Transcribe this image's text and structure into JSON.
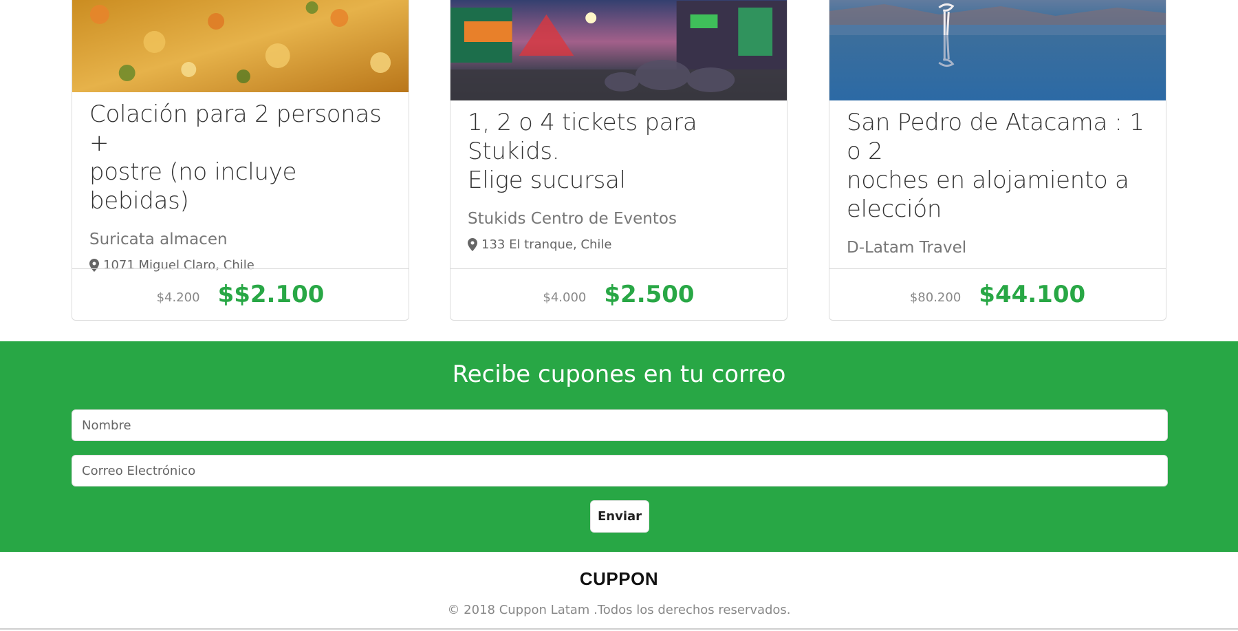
{
  "deals": [
    {
      "image": "food-dish-image",
      "title_line1": "Colación para 2 personas +",
      "title_line2": "postre (no incluye bebidas)",
      "title_line3": "",
      "merchant": "Suricata almacen",
      "address": "1071 Miguel Claro, Chile",
      "old_price": "$4.200",
      "new_price": "$$2.100"
    },
    {
      "image": "amusement-fair-image",
      "title_line1": "1, 2 o 4 tickets para Stukids.",
      "title_line2": "Elige sucursal",
      "title_line3": "",
      "merchant": "Stukids Centro de Eventos",
      "address": "133 El tranque, Chile",
      "old_price": "$4.000",
      "new_price": "$2.500"
    },
    {
      "image": "flamingo-lake-image",
      "title_line1": "San Pedro de Atacama : 1 o 2",
      "title_line2": "noches en alojamiento a",
      "title_line3": "elección",
      "merchant": "D-Latam Travel",
      "address": "",
      "old_price": "$80.200",
      "new_price": "$44.100"
    }
  ],
  "newsletter": {
    "heading": "Recibe cupones en tu correo",
    "name_placeholder": "Nombre",
    "email_placeholder": "Correo Electrónico",
    "submit_label": "Enviar"
  },
  "footer": {
    "brand": "CUPPON",
    "copyright": "© 2018 Cuppon Latam .Todos los derechos reservados."
  },
  "colors": {
    "accent": "#28a745",
    "price": "#28a745"
  },
  "icons": {
    "address": "map-marker-icon"
  }
}
